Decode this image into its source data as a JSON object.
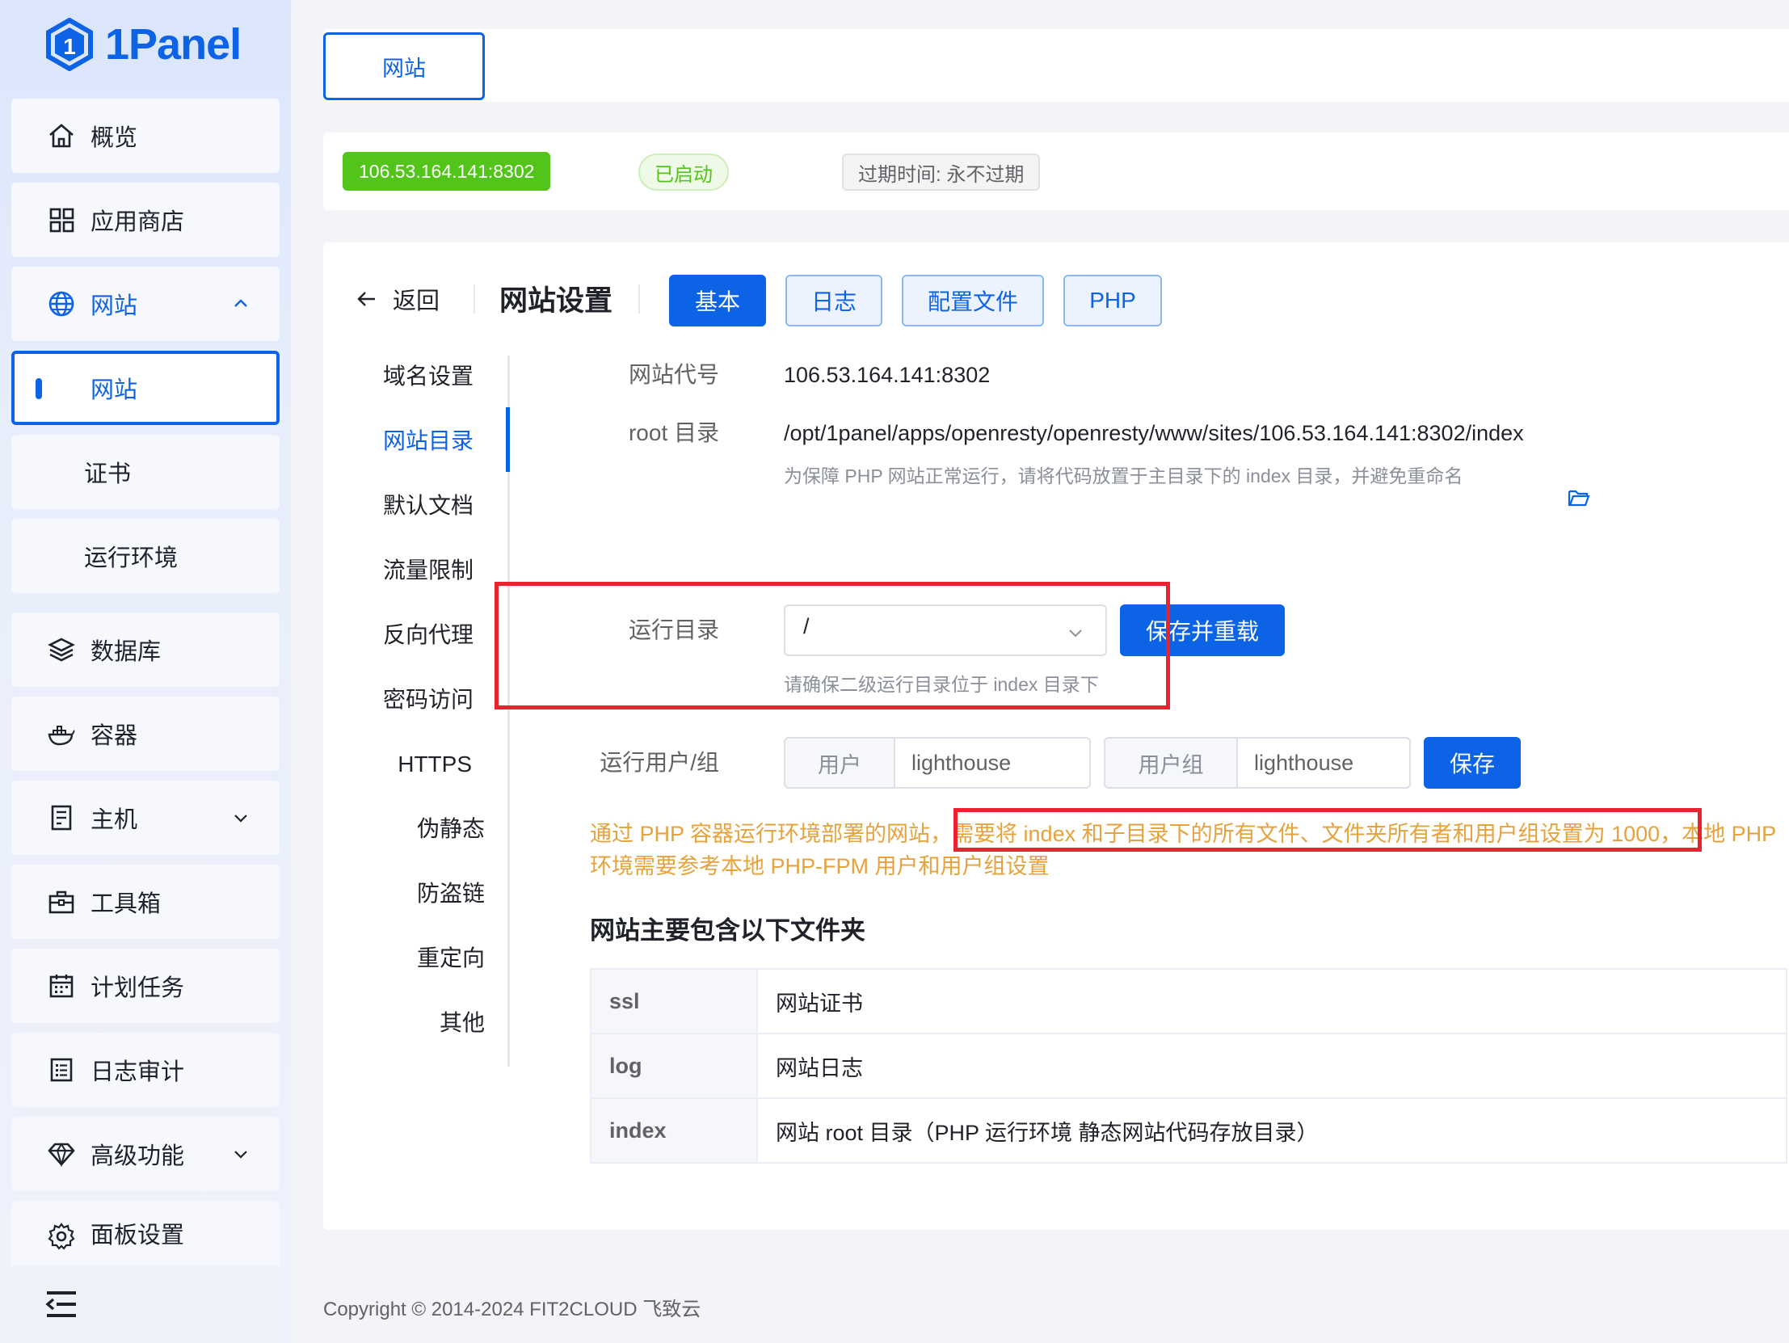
{
  "brand": {
    "name": "1Panel"
  },
  "sidebar": {
    "items": [
      {
        "label": "概览",
        "icon": "home-icon"
      },
      {
        "label": "应用商店",
        "icon": "grid-icon"
      },
      {
        "label": "网站",
        "icon": "globe-icon",
        "expanded": true
      },
      {
        "label": "网站",
        "sub": true,
        "selected": true
      },
      {
        "label": "证书",
        "sub": true
      },
      {
        "label": "运行环境",
        "sub": true
      },
      {
        "label": "数据库",
        "icon": "layers-icon"
      },
      {
        "label": "容器",
        "icon": "docker-icon"
      },
      {
        "label": "主机",
        "icon": "server-icon",
        "expandable": true
      },
      {
        "label": "工具箱",
        "icon": "toolbox-icon"
      },
      {
        "label": "计划任务",
        "icon": "calendar-icon"
      },
      {
        "label": "日志审计",
        "icon": "log-icon"
      },
      {
        "label": "高级功能",
        "icon": "diamond-icon",
        "expandable": true
      },
      {
        "label": "面板设置",
        "icon": "gear-icon"
      }
    ]
  },
  "topbar": {
    "tab_label": "网站"
  },
  "info": {
    "address": "106.53.164.141:8302",
    "status": "已启动",
    "expire": "过期时间: 永不过期"
  },
  "header": {
    "back_label": "返回",
    "title": "网站设置",
    "tabs": [
      "基本",
      "日志",
      "配置文件",
      "PHP"
    ],
    "active_tab": "基本"
  },
  "settings_menu": {
    "items": [
      "域名设置",
      "网站目录",
      "默认文档",
      "流量限制",
      "反向代理",
      "密码访问",
      "HTTPS",
      "伪静态",
      "防盗链",
      "重定向",
      "其他"
    ],
    "current": "网站目录"
  },
  "form": {
    "alias_label": "网站代号",
    "alias_value": "106.53.164.141:8302",
    "root_label": "root 目录",
    "root_value": "/opt/1panel/apps/openresty/openresty/www/sites/106.53.164.141:8302/index",
    "root_hint": "为保障 PHP 网站正常运行，请将代码放置于主目录下的 index 目录，并避免重命名",
    "run_dir_label": "运行目录",
    "run_dir_value": "/",
    "run_dir_button": "保存并重载",
    "run_dir_hint": "请确保二级运行目录位于 index 目录下",
    "user_group_label": "运行用户/组",
    "user_prefix": "用户",
    "user_value": "lighthouse",
    "group_prefix": "用户组",
    "group_value": "lighthouse",
    "save_button": "保存",
    "warning_part1": "通过 PHP 容器运行环境部署的网站，",
    "warning_part2": "需要将 index 和子目录下的所有文件、文件夹所有者和用户组设置为 1000",
    "warning_part3": "，本地 PHP 环境需要参考本地 PHP-FPM 用户和用户组设置"
  },
  "folders": {
    "title": "网站主要包含以下文件夹",
    "rows": [
      {
        "name": "ssl",
        "desc": "网站证书"
      },
      {
        "name": "log",
        "desc": "网站日志"
      },
      {
        "name": "index",
        "desc": "网站 root 目录（PHP 运行环境 静态网站代码存放目录）"
      }
    ]
  },
  "footer": {
    "copyright": "Copyright © 2014-2024 FIT2CLOUD 飞致云"
  },
  "colors": {
    "primary": "#0c63e6",
    "success": "#52c41a",
    "warning": "#e6a23c",
    "highlight": "#e8222e"
  }
}
